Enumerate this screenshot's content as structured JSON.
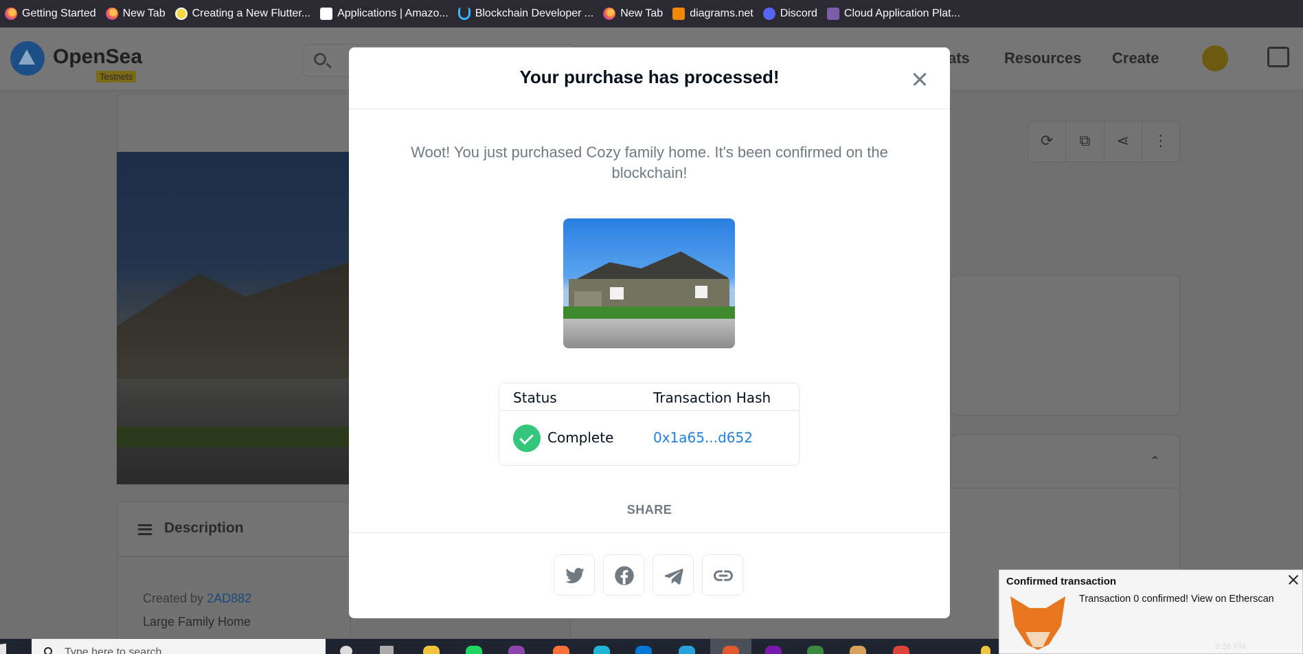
{
  "bookmarks": [
    {
      "label": "Getting Started",
      "icon": "firefox-icon"
    },
    {
      "label": "New Tab",
      "icon": "firefox-icon"
    },
    {
      "label": "Creating a New Flutter...",
      "icon": "flutter-icon"
    },
    {
      "label": "Applications | Amazo...",
      "icon": "amazon-icon"
    },
    {
      "label": "Blockchain Developer ...",
      "icon": "udacity-icon"
    },
    {
      "label": "New Tab",
      "icon": "firefox-icon"
    },
    {
      "label": "diagrams.net",
      "icon": "drawio-icon"
    },
    {
      "label": "Discord",
      "icon": "discord-icon"
    },
    {
      "label": "Cloud Application Plat...",
      "icon": "heroku-icon"
    }
  ],
  "background_page": {
    "brand": "OpenSea",
    "badge": "Testnets",
    "nav": [
      "ats",
      "Resources",
      "Create"
    ],
    "description_title": "Description",
    "created_by_prefix": "Created by",
    "creator": "2AD882",
    "item_desc": "Large Family Home"
  },
  "modal": {
    "title": "Your purchase has processed!",
    "message": "Woot! You just purchased Cozy family home. It's been confirmed on the blockchain!",
    "table": {
      "status_header": "Status",
      "hash_header": "Transaction Hash",
      "status_value": "Complete",
      "hash_value": "0x1a65...d652"
    },
    "share_label": "SHARE",
    "share_buttons": [
      "twitter-icon",
      "facebook-icon",
      "telegram-icon",
      "link-icon"
    ]
  },
  "notification": {
    "title": "Confirmed transaction",
    "text": "Transaction 0 confirmed! View on Etherscan"
  },
  "taskbar": {
    "search_placeholder": "Type here to search",
    "time": "9:36 PM"
  },
  "colors": {
    "accent_link": "#2081e2",
    "success": "#34c77b",
    "title_text": "#04111d",
    "muted_text": "#707a83"
  }
}
